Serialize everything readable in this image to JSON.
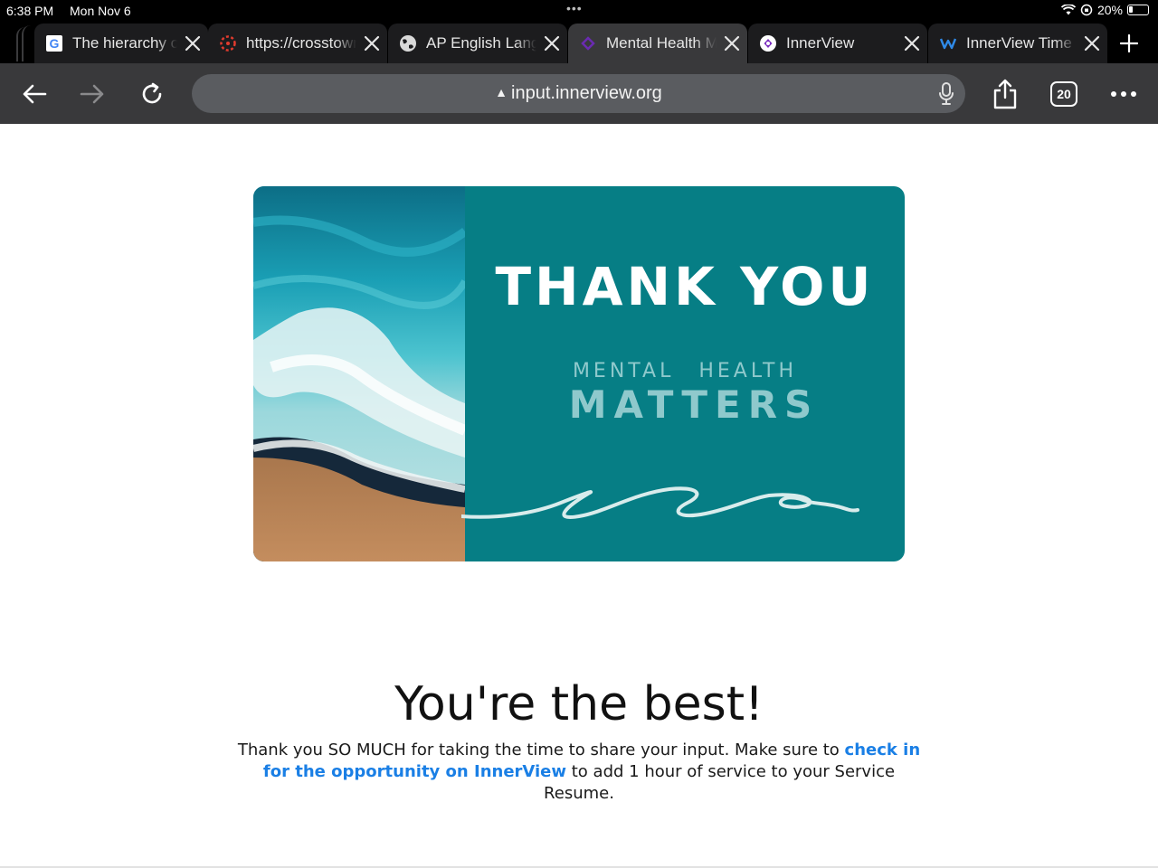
{
  "status_bar": {
    "time": "6:38 PM",
    "date": "Mon Nov 6",
    "battery": "20%"
  },
  "tabs": [
    {
      "title": "The hierarchy of",
      "icon": "google-icon",
      "active": false
    },
    {
      "title": "https://crosstown",
      "icon": "canvas-icon",
      "active": false
    },
    {
      "title": "AP English Language",
      "icon": "globe-icon",
      "active": false
    },
    {
      "title": "Mental Health Matters",
      "icon": "innerview-purple-icon",
      "active": true
    },
    {
      "title": "InnerView",
      "icon": "innerview-icon",
      "active": false
    },
    {
      "title": "InnerView Time",
      "icon": "weebly-icon",
      "active": false
    }
  ],
  "toolbar": {
    "url": "input.innerview.org",
    "tab_count": "20"
  },
  "card": {
    "title": "THANK YOU",
    "subtitle_line1": "MENTAL  HEALTH",
    "subtitle_line2": "MATTERS",
    "teal_color": "#067e85"
  },
  "main": {
    "headline": "You're the best!",
    "message_before": "Thank you SO MUCH for taking the time to share your input. Make sure to ",
    "link_text": "check in for the opportunity on InnerView",
    "message_after": " to add 1 hour of service to your Service Resume.",
    "link_color": "#1a7fe5"
  }
}
